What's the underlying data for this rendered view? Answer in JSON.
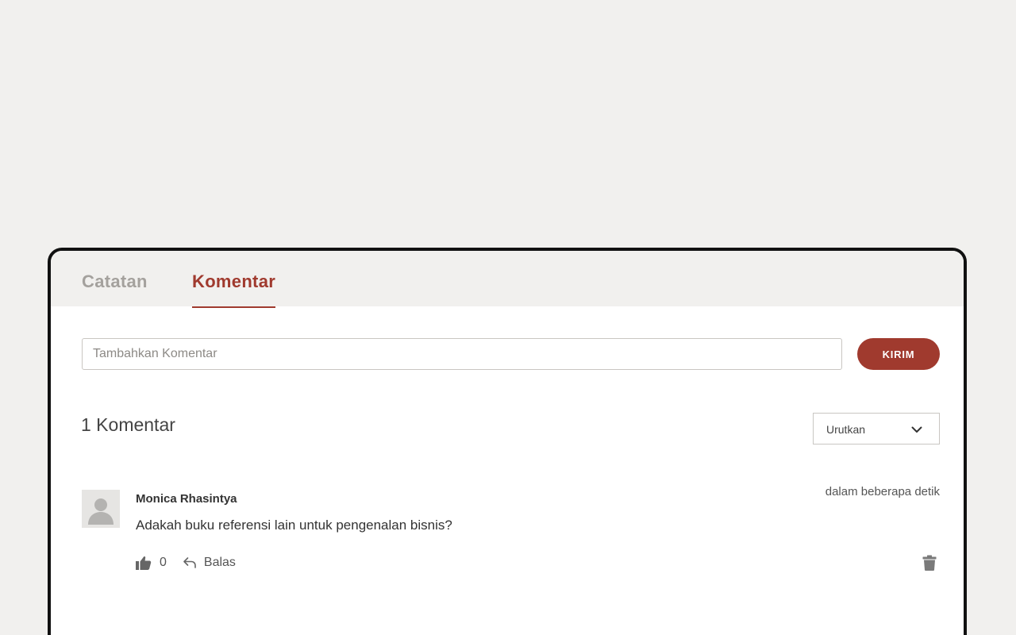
{
  "tabs": [
    {
      "label": "Catatan",
      "active": false
    },
    {
      "label": "Komentar",
      "active": true
    }
  ],
  "composer": {
    "placeholder": "Tambahkan Komentar",
    "value": "",
    "send_label": "KIRIM"
  },
  "comments_header": {
    "count_label": "1 Komentar",
    "sort_label": "Urutkan"
  },
  "comments": [
    {
      "author": "Monica Rhasintya",
      "timestamp": "dalam beberapa detik",
      "text": "Adakah buku referensi lain untuk pengenalan bisnis?",
      "likes": "0",
      "reply_label": "Balas"
    }
  ],
  "icons": {
    "avatar": "user-placeholder-icon",
    "like": "thumbs-up-icon",
    "reply": "reply-arrow-icon",
    "delete": "trash-icon",
    "sort": "chevron-down-icon"
  },
  "colors": {
    "accent": "#a03a2e",
    "background": "#f1f0ee",
    "panel": "#ffffff",
    "inactive_tab": "#a4a19d"
  }
}
